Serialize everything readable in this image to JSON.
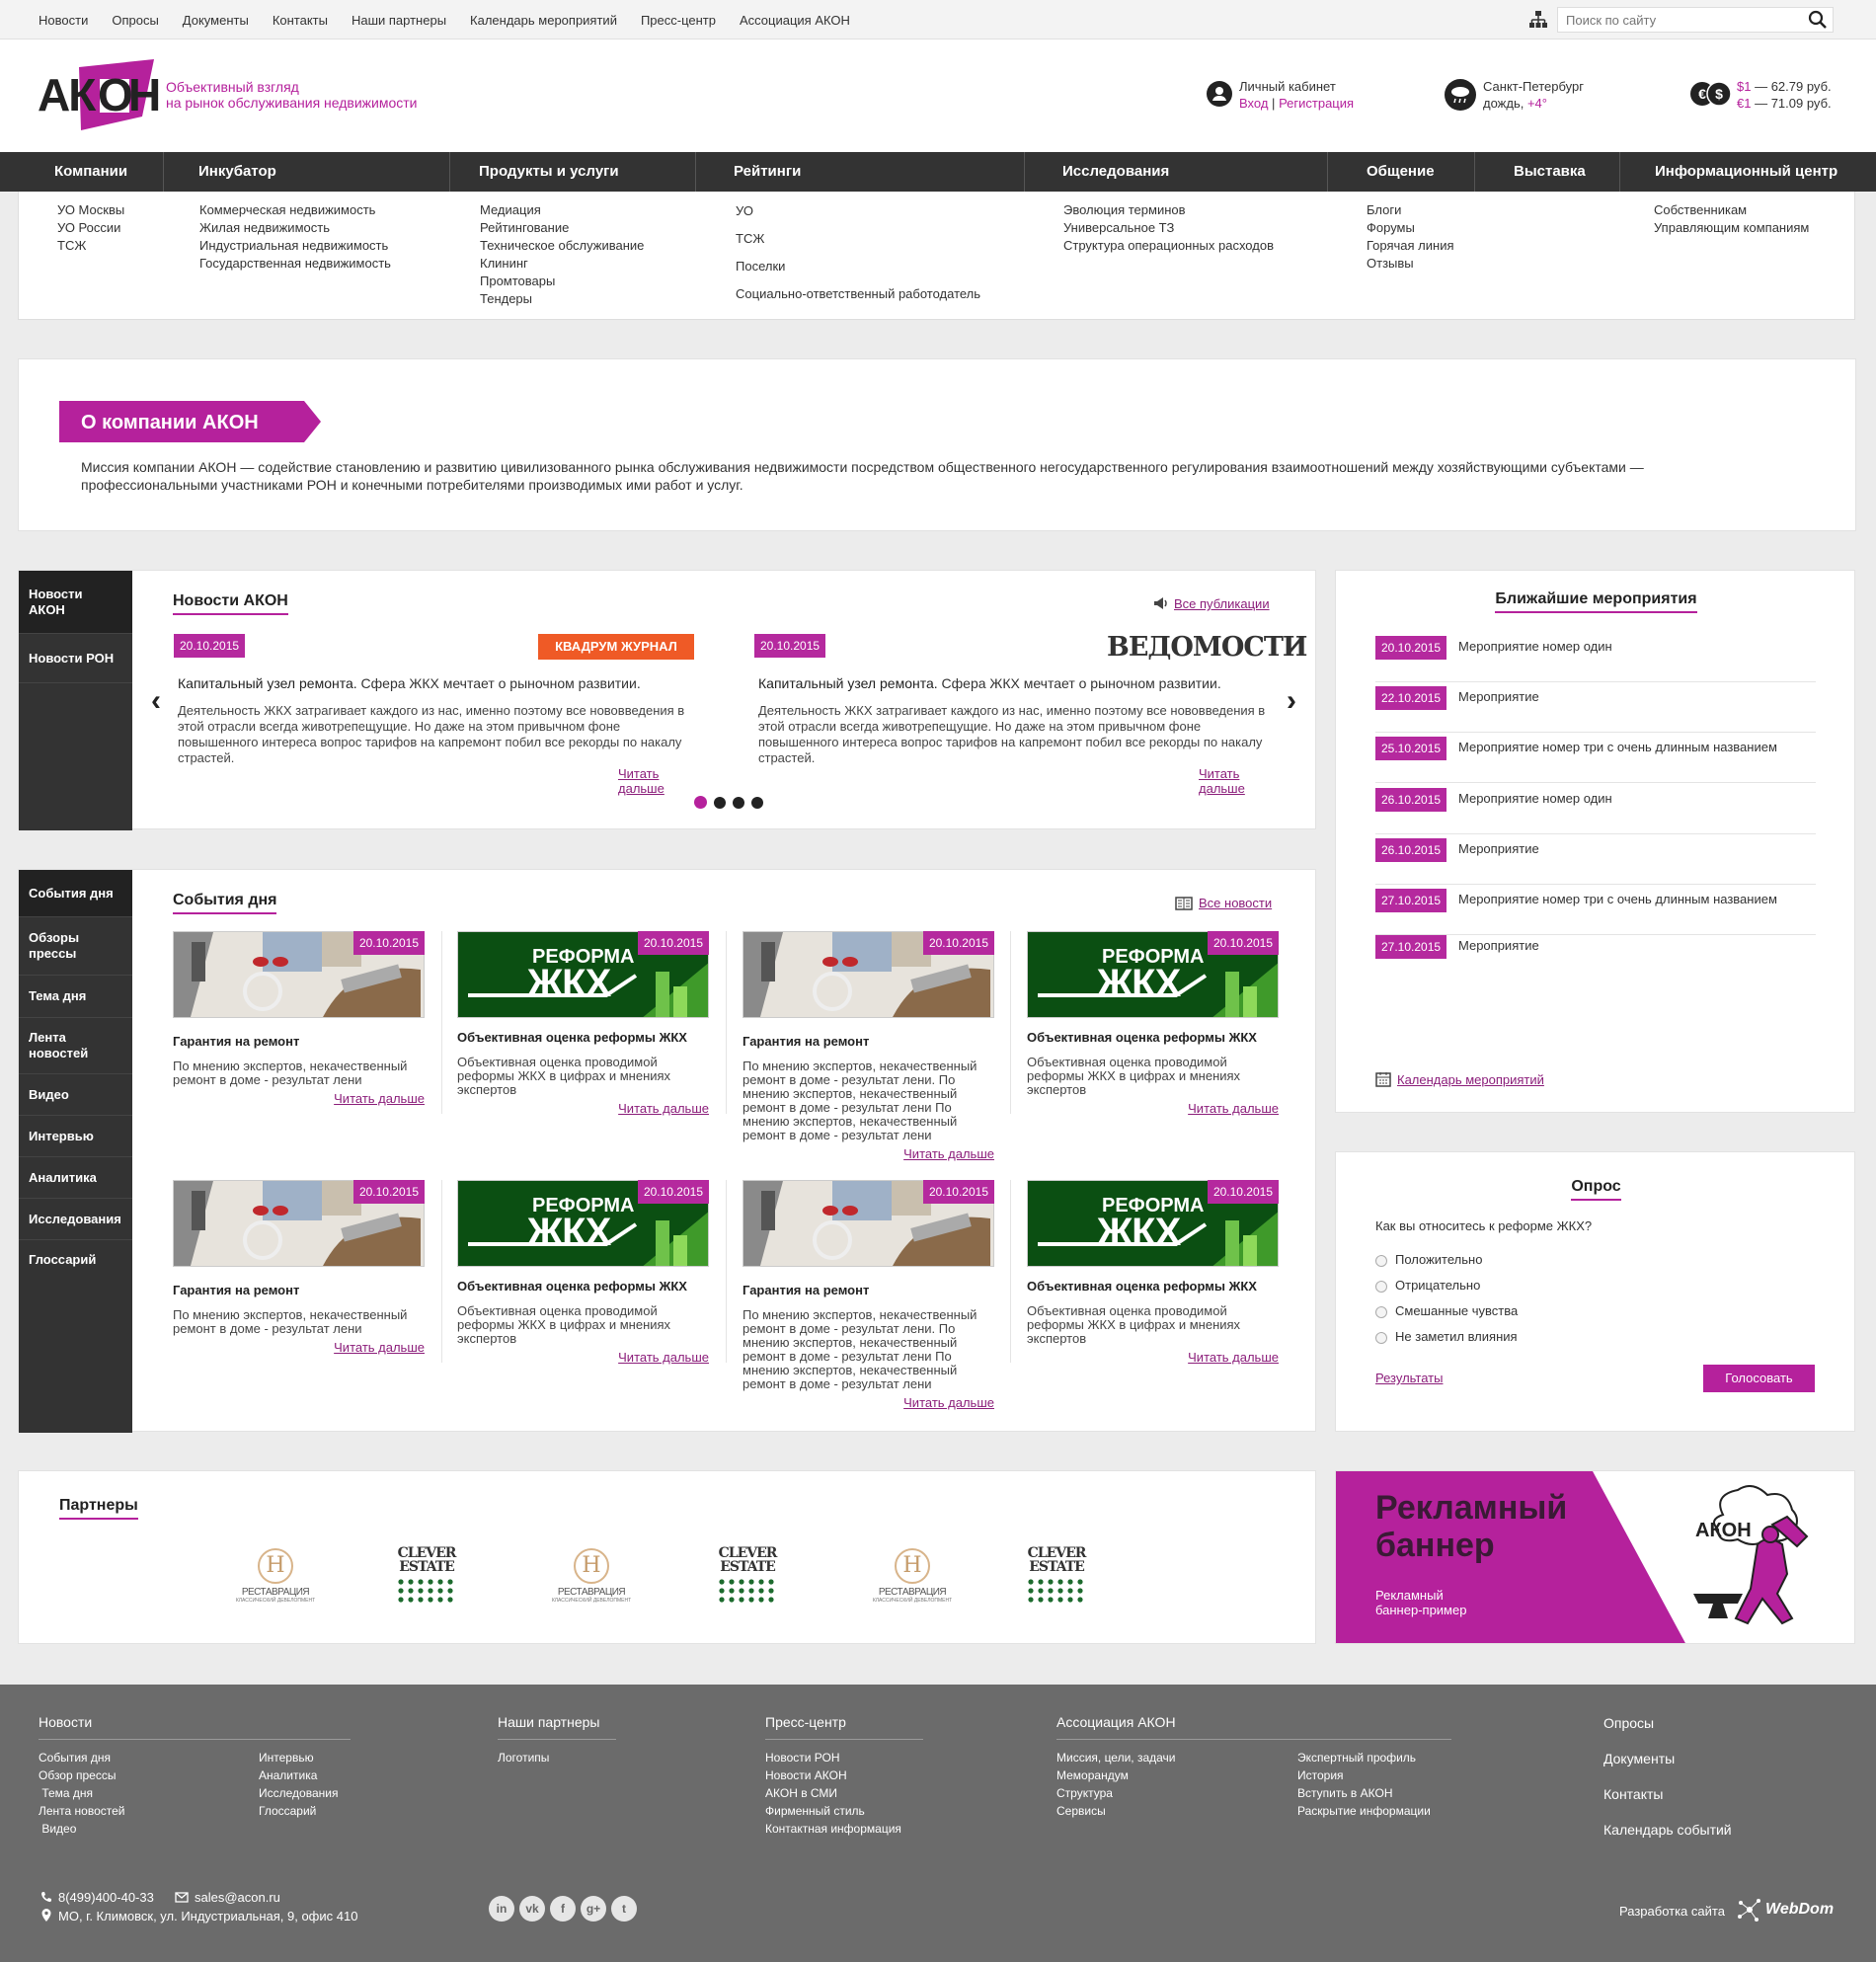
{
  "topnav": {
    "items": [
      "Новости",
      "Опросы",
      "Документы",
      "Контакты",
      "Наши партнеры",
      "Календарь мероприятий",
      "Пресс-центр",
      "Ассоциация АКОН"
    ],
    "search_placeholder": "Поиск по сайту"
  },
  "header": {
    "logo": "АКОН",
    "tagline1": "Объективный взгляд",
    "tagline2": "на рынок обслуживания недвижимости",
    "cabinet": "Личный кабинет",
    "login": "Вход",
    "sep": "|",
    "register": "Регистрация",
    "city": "Санкт-Петербург",
    "weather": "дождь,",
    "temp": "+4°",
    "usd_label": "$1",
    "usd_value": "— 62.79 руб.",
    "eur_label": "€1",
    "eur_value": "— 71.09 руб."
  },
  "mainnav": [
    "Компании",
    "Инкубатор",
    "Продукты и услуги",
    "Рейтинги",
    "Исследования",
    "Общение",
    "Выставка",
    "Информационный центр"
  ],
  "megamenu": {
    "companies": [
      "УО Москвы",
      "УО России",
      "ТСЖ"
    ],
    "incubator": [
      "Коммерческая недвижимость",
      "Жилая недвижимость",
      "Индустриальная недвижимость",
      "Государственная недвижимость"
    ],
    "products": [
      "Медиация",
      "Рейтингование",
      "Техническое обслуживание",
      "Клининг",
      "Промтовары",
      "Тендеры"
    ],
    "ratings": [
      "УО",
      "ТСЖ",
      "Поселки",
      "Социально-ответственный работодатель"
    ],
    "research": [
      "Эволюция терминов",
      "Универсальное ТЗ",
      "Структура операционных расходов"
    ],
    "community": [
      "Блоги",
      "Форумы",
      "Горячая линия",
      "Отзывы"
    ],
    "infocenter": [
      "Собственникам",
      "Управляющим компаниям"
    ]
  },
  "about": {
    "title": "О компании АКОН",
    "text": "Миссия компании АКОН — содействие становлению и развитию цивилизованного рынка обслуживания недвижимости посредством общественного негосударственного регулирования взаимоотношений между хозяйствующими субъектами — профессиональными участниками РОН и конечными потребителями производимых ими работ и услуг."
  },
  "news": {
    "tabs": [
      "Новости АКОН",
      "Новости РОН"
    ],
    "title": "Новости АКОН",
    "all_link": "Все публикации",
    "items": [
      {
        "date": "20.10.2015",
        "source": "КВАДРУМ ЖУРНАЛ",
        "headline_bold": "Капитальный узел ремонта.",
        "headline_rest": "Сфера ЖКХ мечтает о рыночном развитии.",
        "text": "Деятельность ЖКХ затрагивает каждого из нас, именно поэтому все нововведения в этой отрасли всегда животрепещущие. Но даже на этом привычном фоне повышенного интереса вопрос тарифов на капремонт побил все рекорды по накалу страстей.",
        "more": "Читать дальше"
      },
      {
        "date": "20.10.2015",
        "source": "ВЕДОМОСТИ",
        "headline_bold": "Капитальный узел ремонта.",
        "headline_rest": "Сфера ЖКХ мечтает о рыночном развитии.",
        "text": "Деятельность ЖКХ затрагивает каждого из нас, именно поэтому все нововведения в этой отрасли всегда животрепещущие. Но даже на этом привычном фоне повышенного интереса вопрос тарифов на капремонт побил все рекорды по накалу страстей.",
        "more": "Читать дальше"
      }
    ],
    "prev": "‹",
    "next": "›"
  },
  "events_day": {
    "tabs": [
      "События дня",
      "Обзоры прессы",
      "Тема дня",
      "Лента новостей",
      "Видео",
      "Интервью",
      "Аналитика",
      "Исследования",
      "Глоссарий"
    ],
    "title": "События дня",
    "all_link": "Все новости",
    "cards": [
      {
        "date": "20.10.2015",
        "img": "tools",
        "title": "Гарантия на ремонт",
        "text": "По мнению экспертов, некачественный ремонт в доме - результат лени",
        "more": "Читать дальше"
      },
      {
        "date": "20.10.2015",
        "img": "reform",
        "title": "Объективная оценка реформы ЖКХ",
        "text": "Объективная оценка проводимой реформы ЖКХ в цифрах и мнениях экспертов",
        "more": "Читать дальше"
      },
      {
        "date": "20.10.2015",
        "img": "tools",
        "title": "Гарантия на ремонт",
        "text": "По мнению экспертов, некачественный ремонт в доме - результат лени. По мнению экспертов, некачественный ремонт в доме - результат лени По мнению экспертов, некачественный ремонт в доме - результат лени",
        "more": "Читать дальше"
      },
      {
        "date": "20.10.2015",
        "img": "reform",
        "title": "Объективная оценка реформы ЖКХ",
        "text": "Объективная оценка проводимой реформы ЖКХ в цифрах и мнениях экспертов",
        "more": "Читать дальше"
      },
      {
        "date": "20.10.2015",
        "img": "tools",
        "title": "Гарантия на ремонт",
        "text": "По мнению экспертов, некачественный ремонт в доме - результат лени",
        "more": "Читать дальше"
      },
      {
        "date": "20.10.2015",
        "img": "reform",
        "title": "Объективная оценка реформы ЖКХ",
        "text": "Объективная оценка проводимой реформы ЖКХ в цифрах и мнениях экспертов",
        "more": "Читать дальше"
      },
      {
        "date": "20.10.2015",
        "img": "tools",
        "title": "Гарантия на ремонт",
        "text": "По мнению экспертов, некачественный ремонт в доме - результат лени. По мнению экспертов, некачественный ремонт в доме - результат лени По мнению экспертов, некачественный ремонт в доме - результат лени",
        "more": "Читать дальше"
      },
      {
        "date": "20.10.2015",
        "img": "reform",
        "title": "Объективная оценка реформы ЖКХ",
        "text": "Объективная оценка проводимой реформы ЖКХ в цифрах и мнениях экспертов",
        "more": "Читать дальше"
      }
    ],
    "reform_line1": "РЕФОРМА",
    "reform_line2": "ЖКХ"
  },
  "upcoming": {
    "title": "Ближайшие мероприятия",
    "items": [
      {
        "date": "20.10.2015",
        "name": "Мероприятие номер один"
      },
      {
        "date": "22.10.2015",
        "name": "Мероприятие"
      },
      {
        "date": "25.10.2015",
        "name": "Мероприятие номер три с очень длинным названием"
      },
      {
        "date": "26.10.2015",
        "name": "Мероприятие номер один"
      },
      {
        "date": "26.10.2015",
        "name": "Мероприятие"
      },
      {
        "date": "27.10.2015",
        "name": "Мероприятие номер три с очень длинным названием"
      },
      {
        "date": "27.10.2015",
        "name": "Мероприятие"
      }
    ],
    "calendar_link": "Календарь мероприятий"
  },
  "poll": {
    "title": "Опрос",
    "question": "Как вы относитесь к реформе ЖКХ?",
    "options": [
      "Положительно",
      "Отрицательно",
      "Смешанные чувства",
      "Не заметил влияния"
    ],
    "results": "Результаты",
    "vote": "Голосовать"
  },
  "partners": {
    "title": "Партнеры",
    "logos": [
      {
        "type": "restoration",
        "line1": "РЕСТАВРАЦИЯ",
        "line2": "КЛАССИЧЕСКИЙ ДЕВЕЛОПМЕНТ",
        "mark": "H"
      },
      {
        "type": "clever",
        "line1": "CLEVER",
        "line2": "ESTATE"
      },
      {
        "type": "restoration",
        "line1": "РЕСТАВРАЦИЯ",
        "line2": "КЛАССИЧЕСКИЙ ДЕВЕЛОПМЕНТ",
        "mark": "H"
      },
      {
        "type": "clever",
        "line1": "CLEVER",
        "line2": "ESTATE"
      },
      {
        "type": "restoration",
        "line1": "РЕСТАВРАЦИЯ",
        "line2": "КЛАССИЧЕСКИЙ ДЕВЕЛОПМЕНТ",
        "mark": "H"
      },
      {
        "type": "clever",
        "line1": "CLEVER",
        "line2": "ESTATE"
      }
    ]
  },
  "banner": {
    "title1": "Рекламный",
    "title2": "баннер",
    "sub1": "Рекламный",
    "sub2": "баннер-пример",
    "logo": "АКОН"
  },
  "footer": {
    "news_title": "Новости",
    "news_col1": [
      "События дня",
      "Обзор прессы",
      " Тема дня",
      "Лента новостей",
      " Видео"
    ],
    "news_col2": [
      "Интервью",
      "Аналитика",
      "Исследования",
      "Глоссарий"
    ],
    "partners_title": "Наши партнеры",
    "partners_links": [
      "Логотипы"
    ],
    "press_title": "Пресс-центр",
    "press_links": [
      "Новости РОН",
      "Новости АКОН",
      "АКОН в СМИ",
      "Фирменный стиль",
      "Контактная информация"
    ],
    "assoc_title": "Ассоциация АКОН",
    "assoc_col1": [
      "Миссия, цели, задачи",
      "Меморандум",
      "Структура",
      "Сервисы"
    ],
    "assoc_col2": [
      "Экспертный профиль",
      "История",
      "Вступить в АКОН",
      "Раскрытие информации"
    ],
    "right_links": [
      "Опросы",
      "Документы",
      "Контакты",
      "Календарь событий"
    ],
    "phone": "8(499)400-40-33",
    "email": "sales@acon.ru",
    "address": "МО, г. Климовск, ул. Индустриальная, 9, офис 410",
    "social": [
      "in",
      "vk",
      "f",
      "g+",
      "t"
    ],
    "dev_label": "Разработка сайта",
    "dev_name": "WebDom"
  },
  "colors": {
    "accent": "#b5299e",
    "dark": "#333333",
    "footer": "#6b6b6b"
  }
}
